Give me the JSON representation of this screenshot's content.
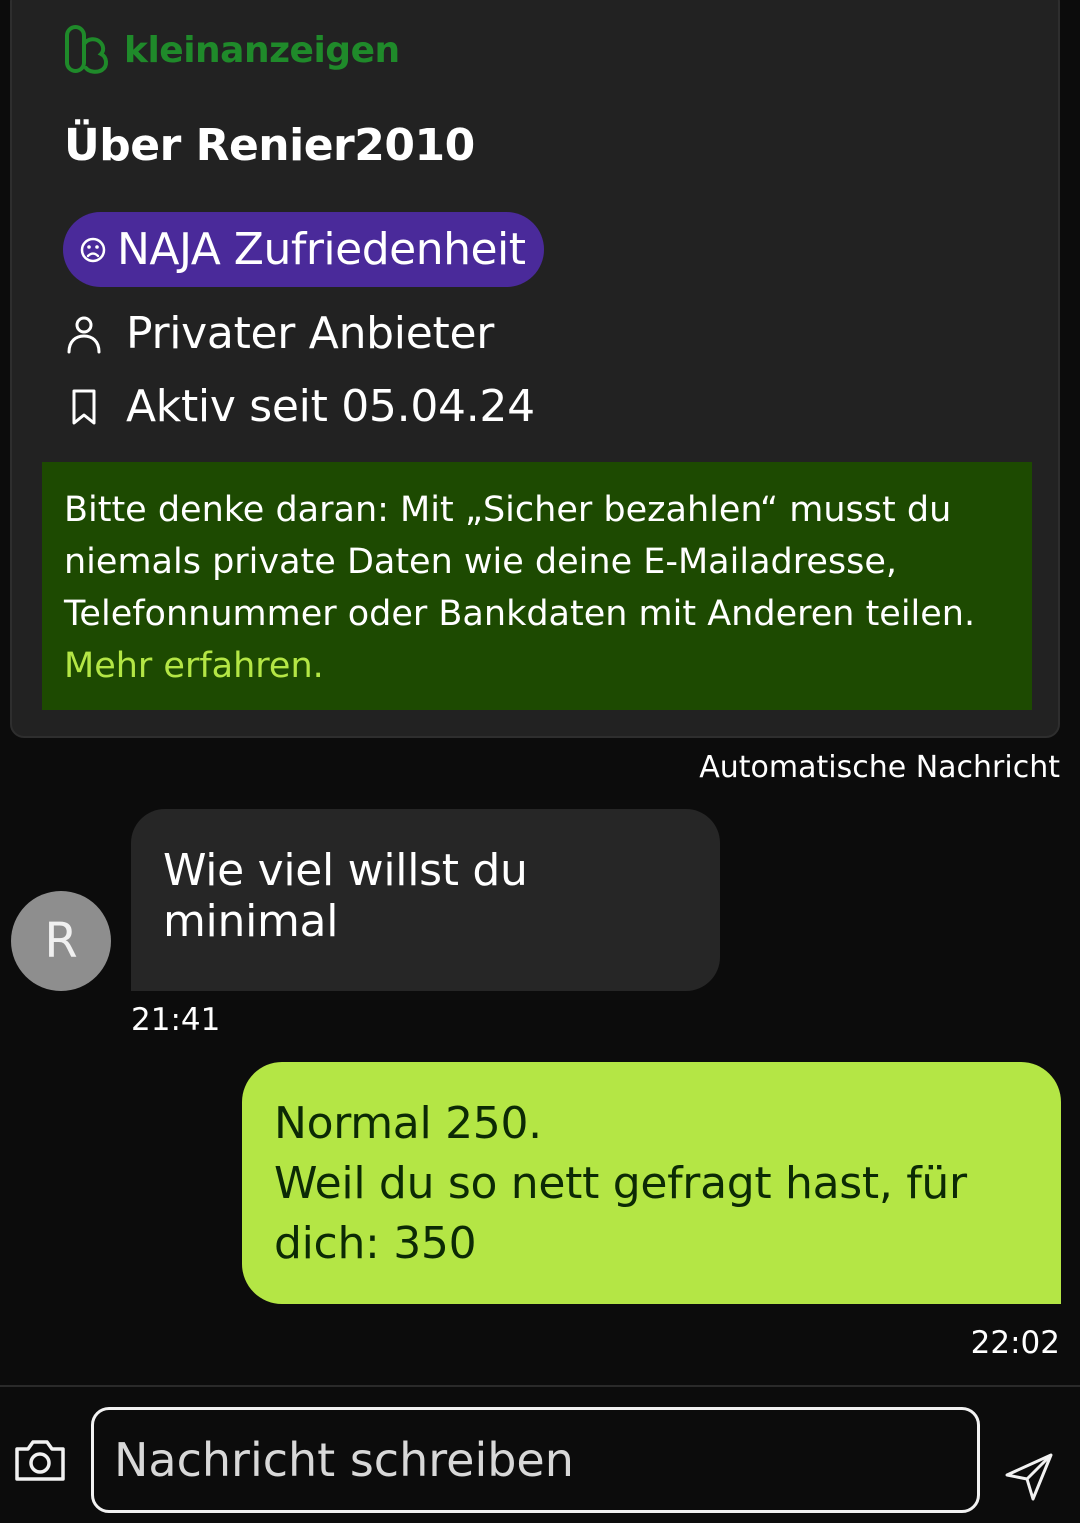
{
  "brand": {
    "name": "kleinanzeigen",
    "color": "#1f8a2a"
  },
  "profile": {
    "title": "Über Renier2010",
    "badge_label": "NAJA Zufriedenheit",
    "badge_icon": "sad-face-icon",
    "seller_type": "Privater Anbieter",
    "active_since": "Aktiv seit 05.04.24"
  },
  "notice": {
    "text": "Bitte denke daran: Mit „Sicher bezahlen“ musst du niemals private Daten wie deine E-Mailadresse, Telefonnummer oder Bankdaten mit Anderen teilen.",
    "link": "Mehr erfahren."
  },
  "auto_label": "Automatische Nachricht",
  "messages": [
    {
      "direction": "incoming",
      "avatar": "R",
      "text": "Wie viel willst du minimal",
      "time": "21:41"
    },
    {
      "direction": "outgoing",
      "lines": [
        "Normal 250.",
        "Weil du so nett gefragt hast, für dich: 350"
      ],
      "time": "22:02"
    }
  ],
  "composer": {
    "placeholder": "Nachricht schreiben"
  },
  "colors": {
    "accent": "#b4e645",
    "badge": "#4a2a9a",
    "notice_bg": "#1d4a01"
  }
}
